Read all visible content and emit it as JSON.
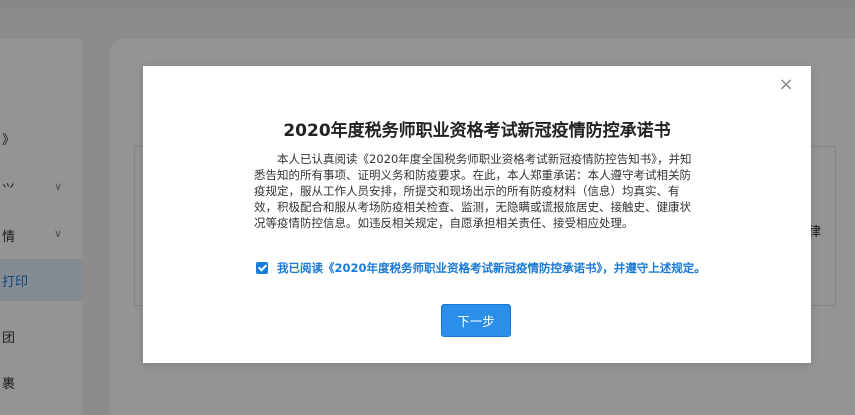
{
  "sidebar": {
    "items": [
      {
        "label": "》",
        "chevron": ""
      },
      {
        "label": "⺍",
        "chevron": "∨"
      },
      {
        "label": "情",
        "chevron": "∨"
      },
      {
        "label": "打印",
        "chevron": ""
      },
      {
        "label": "团",
        "chevron": ""
      },
      {
        "label": "裹",
        "chevron": ""
      }
    ]
  },
  "background": {
    "partial_text": "律"
  },
  "modal": {
    "close_icon": "×",
    "title": "2020年度税务师职业资格考试新冠疫情防控承诺书",
    "body": "本人已认真阅读《2020年度全国税务师职业资格考试新冠疫情防控告知书》，并知悉告知的所有事项、证明义务和防疫要求。在此，本人郑重承诺：本人遵守考试相关防疫规定，服从工作人员安排，所提交和现场出示的所有防疫材料（信息）均真实、有效，积极配合和服从考场防疫相关检查、监测，无隐瞒或谎报旅居史、接触史、健康状况等疫情防控信息。如违反相关规定，自愿承担相关责任、接受相应处理。",
    "agree_text": "我已阅读《2020年度税务师职业资格考试新冠疫情防控承诺书》，并遵守上述规定。",
    "agree_checked": true,
    "next_button": "下一步"
  },
  "colors": {
    "accent": "#1a7ad6",
    "button": "#2a8fe8",
    "overlay": "rgba(0,0,0,0.42)"
  }
}
